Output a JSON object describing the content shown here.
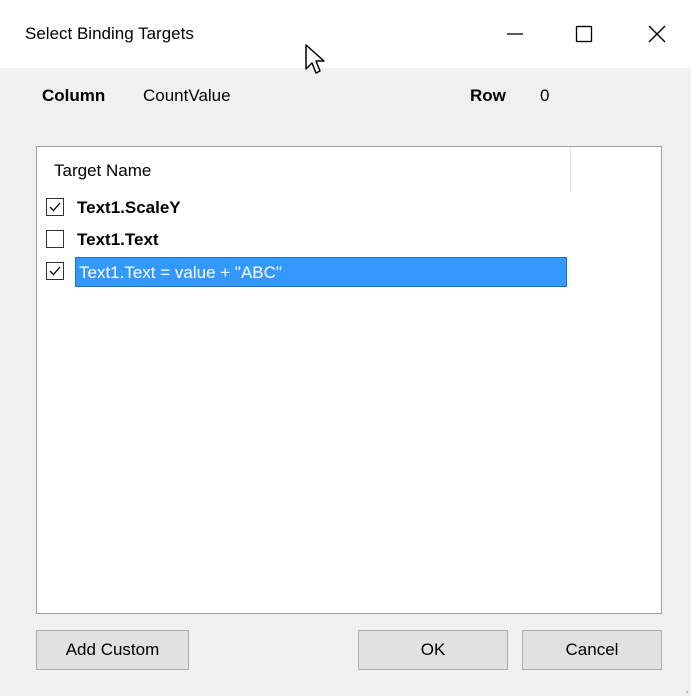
{
  "window": {
    "title": "Select Binding Targets"
  },
  "info": {
    "column_label": "Column",
    "column_value": "CountValue",
    "row_label": "Row",
    "row_value": "0"
  },
  "list": {
    "header": "Target Name",
    "items": [
      {
        "label": "Text1.ScaleY",
        "checked": true,
        "bold": true,
        "selected": false
      },
      {
        "label": "Text1.Text",
        "checked": false,
        "bold": true,
        "selected": false
      },
      {
        "label": "Text1.Text = value + \"ABC\"",
        "checked": true,
        "bold": false,
        "selected": true
      }
    ]
  },
  "buttons": {
    "add_custom": "Add Custom",
    "ok": "OK",
    "cancel": "Cancel"
  },
  "colors": {
    "selection": "#3399ff",
    "window_bg": "#f0f0f0",
    "button_bg": "#e1e1e1"
  },
  "icons": {
    "minimize": "minimize-icon",
    "maximize": "maximize-icon",
    "close": "close-icon",
    "check": "checkmark-icon",
    "cursor": "mouse-pointer-icon"
  }
}
